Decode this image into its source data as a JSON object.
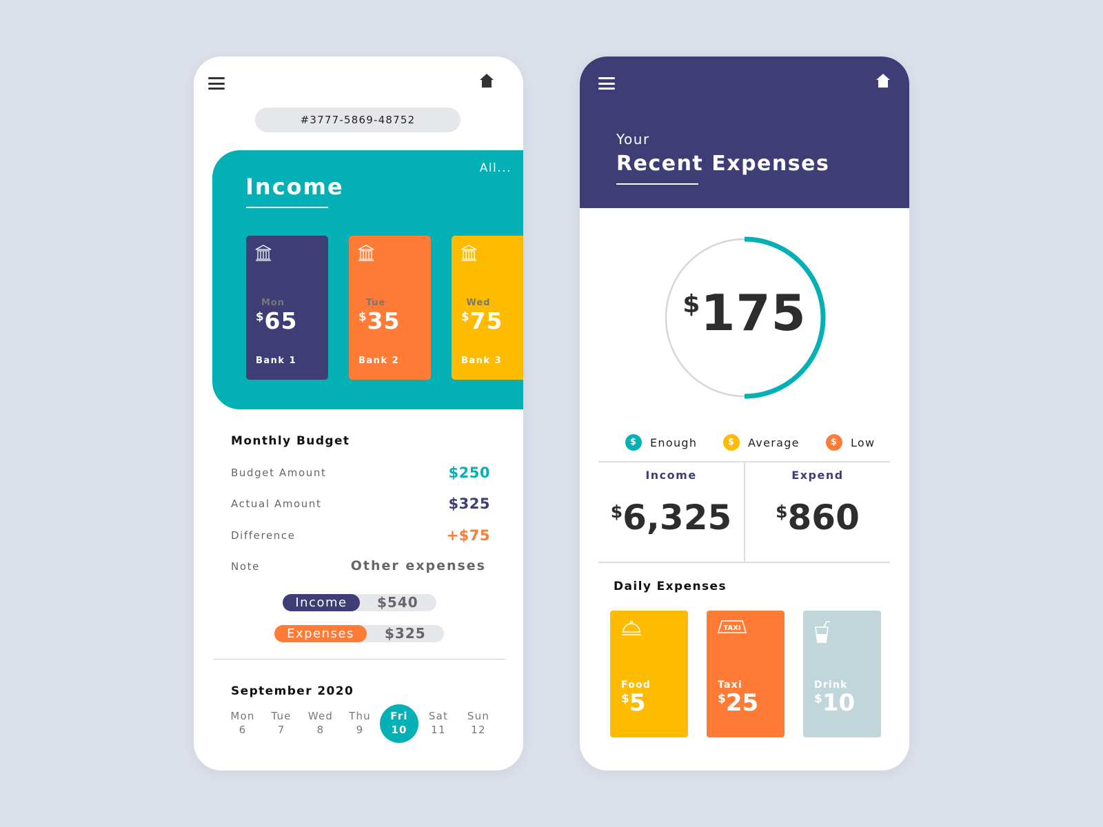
{
  "colors": {
    "teal": "#03b0b6",
    "purple": "#3f3d75",
    "orange": "#ff7b36",
    "yellow": "#ffbb00",
    "light_blue": "#c0d6db",
    "background": "#dbe0ea"
  },
  "left": {
    "menu_icon": "hamburger-icon",
    "home_icon": "home-icon",
    "account_number": "#3777-5869-48752",
    "income": {
      "title": "Income",
      "all_link": "All...",
      "banks": [
        {
          "day": "Mon",
          "currency": "$",
          "amount": "65",
          "name": "Bank 1",
          "icon": "bank-icon"
        },
        {
          "day": "Tue",
          "currency": "$",
          "amount": "35",
          "name": "Bank 2",
          "icon": "bank-icon"
        },
        {
          "day": "Wed",
          "currency": "$",
          "amount": "75",
          "name": "Bank 3",
          "icon": "bank-icon"
        }
      ]
    },
    "budget": {
      "title": "Monthly Budget",
      "rows": [
        {
          "label": "Budget Amount",
          "value": "$250"
        },
        {
          "label": "Actual Amount",
          "value": "$325"
        },
        {
          "label": "Difference",
          "value": "+$75"
        },
        {
          "label": "Note",
          "value": "Other expenses"
        }
      ],
      "bars": [
        {
          "label": "Income",
          "value": "$540"
        },
        {
          "label": "Expenses",
          "value": "$325"
        }
      ]
    },
    "calendar": {
      "title": "September 2020",
      "days": [
        {
          "d": "Mon",
          "n": "6"
        },
        {
          "d": "Tue",
          "n": "7"
        },
        {
          "d": "Wed",
          "n": "8"
        },
        {
          "d": "Thu",
          "n": "9"
        },
        {
          "d": "Fri",
          "n": "10",
          "selected": true
        },
        {
          "d": "Sat",
          "n": "11"
        },
        {
          "d": "Sun",
          "n": "12"
        }
      ]
    }
  },
  "right": {
    "menu_icon": "hamburger-icon",
    "home_icon": "home-icon",
    "subtitle": "Your",
    "title": "Recent Expenses",
    "gauge": {
      "currency": "$",
      "amount": "175",
      "fill_fraction": 0.5
    },
    "legend": [
      {
        "label": "Enough",
        "symbol": "$"
      },
      {
        "label": "Average",
        "symbol": "$"
      },
      {
        "label": "Low",
        "symbol": "$"
      }
    ],
    "income": {
      "label": "Income",
      "currency": "$",
      "amount": "6,325"
    },
    "expend": {
      "label": "Expend",
      "currency": "$",
      "amount": "860"
    },
    "daily": {
      "title": "Daily Expenses",
      "items": [
        {
          "name": "Food",
          "currency": "$",
          "amount": "5",
          "icon": "food-cloche-icon"
        },
        {
          "name": "Taxi",
          "currency": "$",
          "amount": "25",
          "icon": "taxi-icon",
          "icon_text": "TAXI"
        },
        {
          "name": "Drink",
          "currency": "$",
          "amount": "10",
          "icon": "drink-icon"
        }
      ]
    }
  }
}
